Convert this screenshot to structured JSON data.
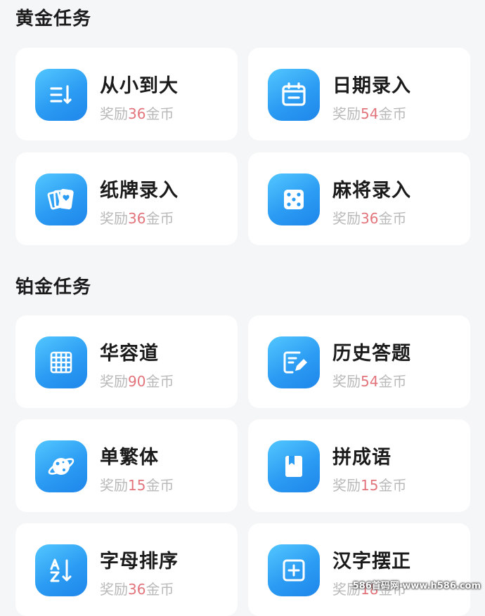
{
  "sections": [
    {
      "title": "黄金任务",
      "tasks": [
        {
          "title": "从小到大",
          "reward_prefix": "奖励",
          "reward_amount": "36",
          "reward_suffix": "金币",
          "icon": "sort-ascending-icon"
        },
        {
          "title": "日期录入",
          "reward_prefix": "奖励",
          "reward_amount": "54",
          "reward_suffix": "金币",
          "icon": "calendar-icon"
        },
        {
          "title": "纸牌录入",
          "reward_prefix": "奖励",
          "reward_amount": "36",
          "reward_suffix": "金币",
          "icon": "playing-cards-icon"
        },
        {
          "title": "麻将录入",
          "reward_prefix": "奖励",
          "reward_amount": "36",
          "reward_suffix": "金币",
          "icon": "dice-icon"
        }
      ]
    },
    {
      "title": "铂金任务",
      "tasks": [
        {
          "title": "华容道",
          "reward_prefix": "奖励",
          "reward_amount": "90",
          "reward_suffix": "金币",
          "icon": "grid-icon"
        },
        {
          "title": "历史答题",
          "reward_prefix": "奖励",
          "reward_amount": "54",
          "reward_suffix": "金币",
          "icon": "edit-note-icon"
        },
        {
          "title": "单繁体",
          "reward_prefix": "奖励",
          "reward_amount": "15",
          "reward_suffix": "金币",
          "icon": "planet-icon"
        },
        {
          "title": "拼成语",
          "reward_prefix": "奖励",
          "reward_amount": "15",
          "reward_suffix": "金币",
          "icon": "bookmark-book-icon"
        },
        {
          "title": "字母排序",
          "reward_prefix": "奖励",
          "reward_amount": "36",
          "reward_suffix": "金币",
          "icon": "sort-az-icon"
        },
        {
          "title": "汉字摆正",
          "reward_prefix": "奖励",
          "reward_amount": "18",
          "reward_suffix": "金币",
          "icon": "center-focus-icon"
        }
      ]
    }
  ],
  "watermark": "586首码网 www.h586.com",
  "colors": {
    "background": "#f5f6f8",
    "card": "#ffffff",
    "icon_gradient_start": "#52c7ff",
    "icon_gradient_end": "#1f86ea",
    "reward_amount": "#e2747c",
    "reward_label": "#b9b9b9",
    "title": "#1b1b1b"
  }
}
